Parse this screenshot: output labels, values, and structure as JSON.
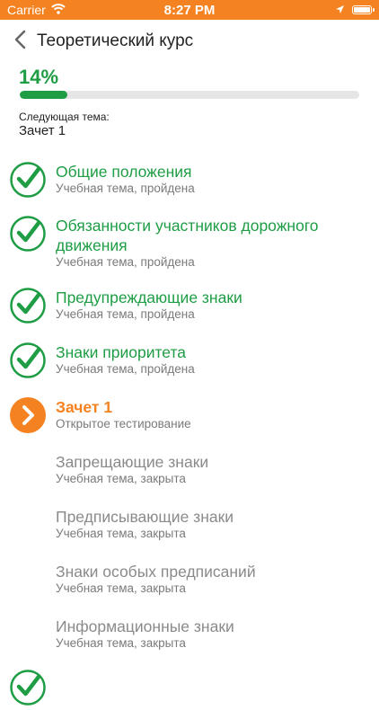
{
  "status_bar": {
    "carrier": "Carrier",
    "time": "8:27 PM",
    "color": "#f58220"
  },
  "nav": {
    "back_icon": "chevron-left-icon",
    "title": "Теоретический курс"
  },
  "progress": {
    "percent_label": "14%",
    "fraction": 0.14,
    "color": "#1e9d45"
  },
  "next_topic": {
    "label": "Следующая тема:",
    "value": "Зачет 1"
  },
  "items": [
    {
      "title": "Общие положения",
      "subtitle": "Учебная тема, пройдена",
      "state": "done",
      "icon": "check-circle-icon"
    },
    {
      "title": "Обязанности участников дорожного движения",
      "subtitle": "Учебная тема, пройдена",
      "state": "done",
      "icon": "check-circle-icon"
    },
    {
      "title": "Предупреждающие знаки",
      "subtitle": "Учебная тема, пройдена",
      "state": "done",
      "icon": "check-circle-icon"
    },
    {
      "title": "Знаки приоритета",
      "subtitle": "Учебная тема, пройдена",
      "state": "done",
      "icon": "check-circle-icon"
    },
    {
      "title": "Зачет 1",
      "subtitle": "Открытое тестирование",
      "state": "current",
      "icon": "chevron-right-circle-icon"
    },
    {
      "title": "Запрещающие знаки",
      "subtitle": "Учебная тема, закрыта",
      "state": "locked"
    },
    {
      "title": "Предписывающие знаки",
      "subtitle": "Учебная тема, закрыта",
      "state": "locked"
    },
    {
      "title": "Знаки особых предписаний",
      "subtitle": "Учебная тема, закрыта",
      "state": "locked"
    },
    {
      "title": "Информационные знаки",
      "subtitle": "Учебная тема, закрыта",
      "state": "locked"
    }
  ],
  "colors": {
    "done": "#1e9d45",
    "current": "#f58220",
    "locked": "#8a8a8a"
  }
}
